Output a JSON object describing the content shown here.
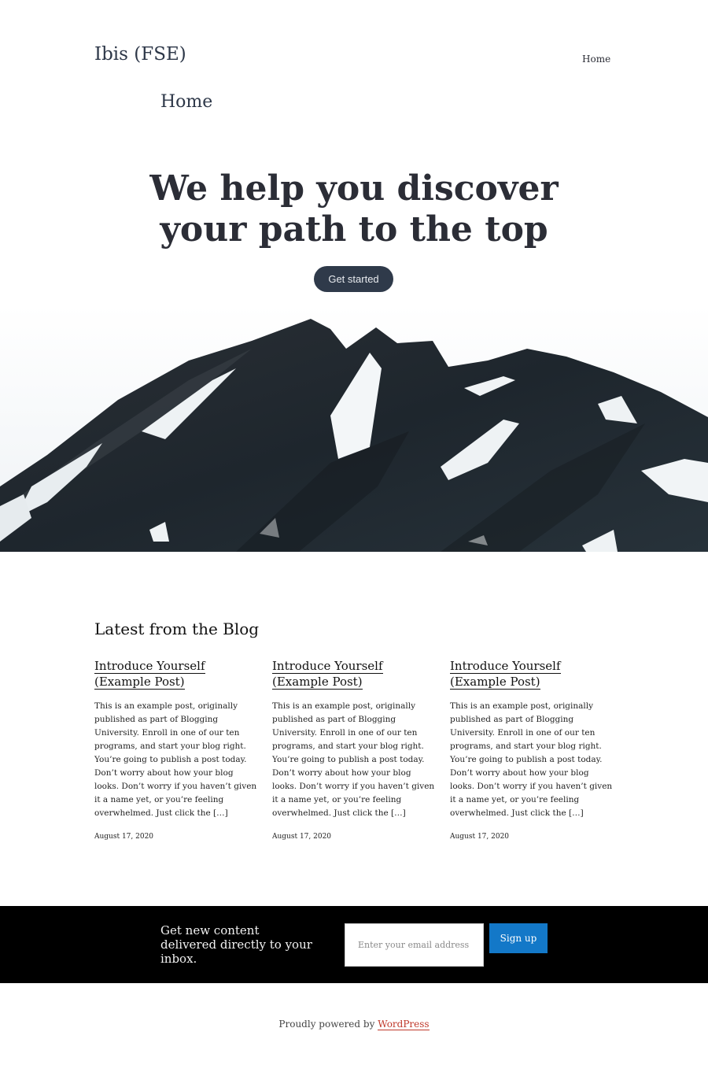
{
  "header": {
    "site_title": "Ibis (FSE)",
    "nav_home": "Home"
  },
  "page": {
    "title": "Home"
  },
  "hero": {
    "heading_line1": "We help you discover",
    "heading_line2": "your path to the top",
    "cta_label": "Get started"
  },
  "blog": {
    "heading": "Latest from the Blog",
    "posts": [
      {
        "title": "Introduce Yourself (Example Post)",
        "excerpt": "This is an example post, originally published as part of Blogging University. Enroll in one of our ten programs, and start your blog right. You’re going to publish a post today. Don’t worry about how your blog looks. Don’t worry if you haven’t given it a name yet, or you’re feeling overwhelmed. Just click the […]",
        "date": "August 17, 2020"
      },
      {
        "title": "Introduce Yourself (Example Post)",
        "excerpt": "This is an example post, originally published as part of Blogging University. Enroll in one of our ten programs, and start your blog right. You’re going to publish a post today. Don’t worry about how your blog looks. Don’t worry if you haven’t given it a name yet, or you’re feeling overwhelmed. Just click the […]",
        "date": "August 17, 2020"
      },
      {
        "title": "Introduce Yourself (Example Post)",
        "excerpt": "This is an example post, originally published as part of Blogging University. Enroll in one of our ten programs, and start your blog right. You’re going to publish a post today. Don’t worry about how your blog looks. Don’t worry if you haven’t given it a name yet, or you’re feeling overwhelmed. Just click the […]",
        "date": "August 17, 2020"
      }
    ]
  },
  "newsletter": {
    "text": "Get new content delivered directly to your inbox.",
    "email_placeholder": "Enter your email address",
    "signup_label": "Sign up",
    "button_color": "#1378c8"
  },
  "footer": {
    "prefix": "Proudly powered by",
    "link_text": "WordPress",
    "link_color": "#c0392b"
  }
}
